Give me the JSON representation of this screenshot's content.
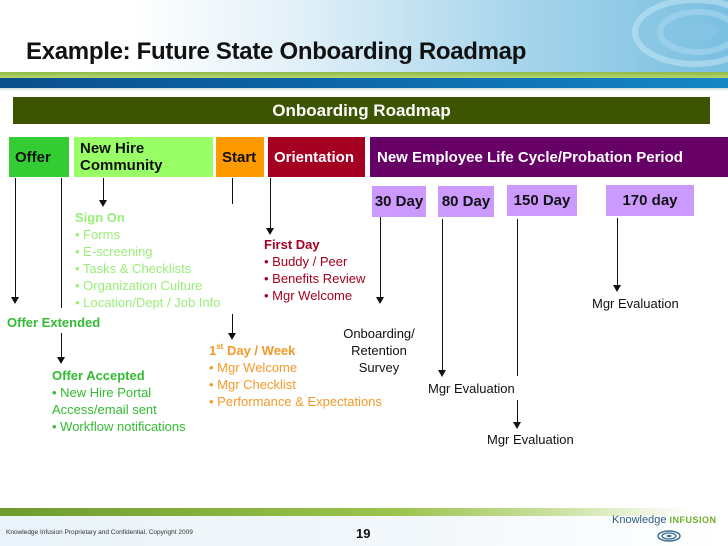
{
  "slide": {
    "title": "Example:  Future State Onboarding Roadmap",
    "roadmap_header": "Onboarding Roadmap",
    "colors": {
      "roadmap_bar": "#3d5400",
      "offer": "#33cc33",
      "new_hire_community": "#99ff66",
      "start": "#ff9900",
      "orientation": "#a50021",
      "life_cycle": "#660066",
      "day_markers": "#cc99ff"
    }
  },
  "phases": {
    "offer": "Offer",
    "new_hire_community_line1": "New Hire",
    "new_hire_community_line2": "Community",
    "start": "Start",
    "orientation": "Orientation",
    "life_cycle": "New Employee Life Cycle/Probation Period"
  },
  "milestones": {
    "d30": "30 Day",
    "d80": "80 Day",
    "d150": "150 Day",
    "d170": "170 day"
  },
  "notes": {
    "sign_on": {
      "heading": "Sign On",
      "items": [
        "• Forms",
        "• E-screening",
        "• Tasks & Checklists",
        "• Organization Culture",
        "• Location/Dept / Job Info"
      ]
    },
    "offer_extended": "Offer Extended",
    "offer_accepted": {
      "heading": "Offer Accepted",
      "items": [
        "• New Hire Portal",
        "Access/email sent",
        "• Workflow notifications"
      ]
    },
    "first_day": {
      "heading": "First Day",
      "items": [
        "• Buddy / Peer",
        "• Benefits Review",
        "• Mgr Welcome"
      ]
    },
    "first_week": {
      "heading_num": "1",
      "heading_sup": "st",
      "heading_rest": " Day / Week",
      "items": [
        "• Mgr Welcome",
        "• Mgr Checklist",
        "• Performance & Expectations"
      ]
    },
    "survey": [
      "Onboarding/",
      "Retention",
      "Survey"
    ],
    "mgr_eval_80": "Mgr Evaluation",
    "mgr_eval_150": "Mgr Evaluation",
    "mgr_eval_170": "Mgr Evaluation"
  },
  "footer": {
    "copyright": "Knowledge Infusion Proprietary and Confidential, Copyright 2009",
    "page_number": "19",
    "logo_word1": "Knowledge",
    "logo_word2": "INFUSION"
  }
}
